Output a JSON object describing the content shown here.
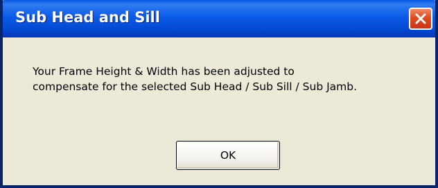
{
  "dialog": {
    "title": "Sub Head and Sill",
    "message_lines": [
      "Your Frame Height & Width has been adjusted to",
      "compensate for the selected Sub Head / Sub Sill / Sub Jamb."
    ],
    "ok_label": "OK",
    "close_icon": "close-icon"
  },
  "colors": {
    "titlebar": "#0b5be8",
    "body": "#ece9d8",
    "close_button": "#dd4b21"
  }
}
